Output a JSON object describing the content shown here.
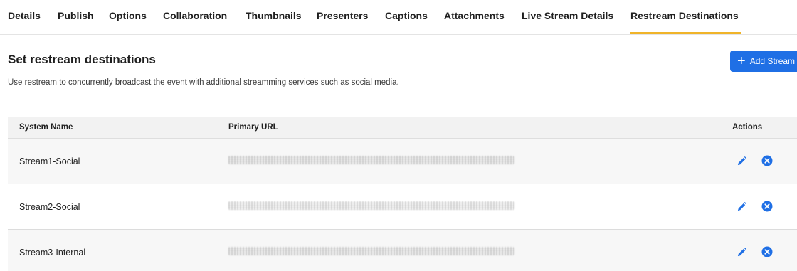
{
  "tabs": [
    {
      "label": "Details"
    },
    {
      "label": "Publish"
    },
    {
      "label": "Options"
    },
    {
      "label": "Collaboration"
    },
    {
      "label": "Thumbnails"
    },
    {
      "label": "Presenters"
    },
    {
      "label": "Captions"
    },
    {
      "label": "Attachments"
    },
    {
      "label": "Live Stream Details"
    },
    {
      "label": "Restream Destinations",
      "active": true
    }
  ],
  "section": {
    "title": "Set restream destinations",
    "description": "Use restream to concurrently broadcast the event with additional streamming services such as social media.",
    "add_button_label": "Add Stream"
  },
  "table": {
    "columns": [
      "System Name",
      "Primary URL",
      "Actions"
    ],
    "rows": [
      {
        "system_name": "Stream1-Social"
      },
      {
        "system_name": "Stream2-Social"
      },
      {
        "system_name": "Stream3-Internal"
      }
    ]
  },
  "colors": {
    "accent": "#1f6fe5",
    "active_tab_underline": "#f0b429",
    "action_icon": "#1f6fe5"
  },
  "icons": {
    "add": "plus-icon",
    "edit": "pencil-icon",
    "delete": "close-circle-icon"
  }
}
